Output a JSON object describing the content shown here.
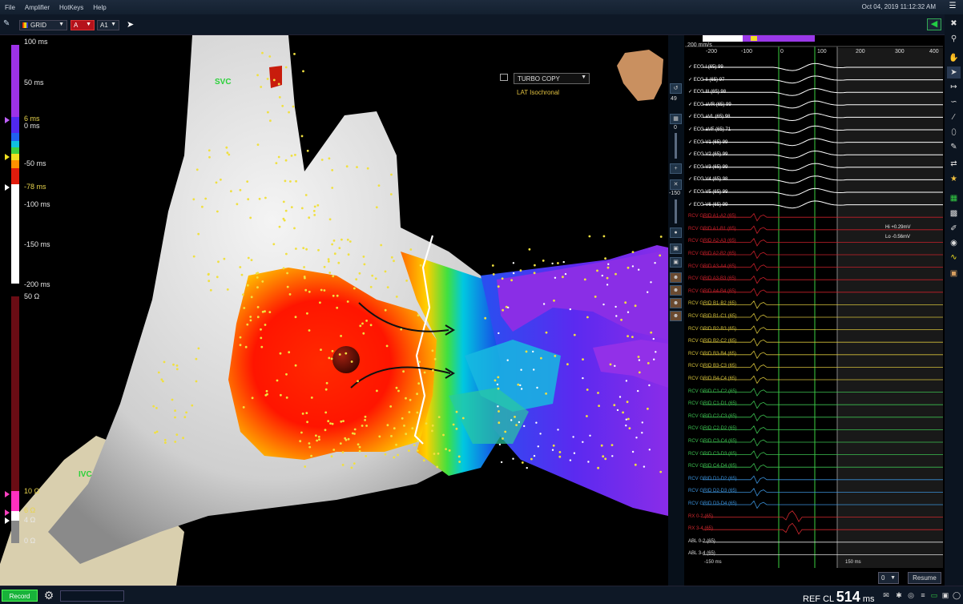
{
  "menu": {
    "items": [
      "File",
      "Amplifier",
      "HotKeys",
      "Help"
    ],
    "datetime": "Oct 04, 2019 11:12:32 AM"
  },
  "toolbar": {
    "map_select": "GRID",
    "channel_a": "A",
    "channel_b": "A1"
  },
  "lat_scale": {
    "labels": [
      "100 ms",
      "50 ms",
      "6 ms",
      "0 ms",
      "-50 ms",
      "-78 ms",
      "-100 ms",
      "-150 ms",
      "-200 ms"
    ]
  },
  "impedance_scale": {
    "labels": [
      "50 Ω",
      "10 Ω",
      "6 Ω",
      "4 Ω",
      "0 Ω"
    ]
  },
  "map": {
    "copy_mode": "TURBO COPY",
    "map_type": "LAT Isochronal",
    "label_svc": "SVC",
    "label_ivc": "IVC"
  },
  "midbar": {
    "value_49": "49",
    "value_0": "0",
    "value_neg150": "-150"
  },
  "traces": {
    "sweep": "200 mm/s",
    "axis_ticks": [
      "-200",
      "-100",
      "0",
      "100",
      "200",
      "300",
      "400"
    ],
    "window_left": "-150 ms",
    "window_right": "150 ms",
    "hi_label": "Hi +0.29mV",
    "lo_label": "Lo -0.56mV",
    "ecg": [
      "ECG I (65) 99",
      "ECG II (65) 97",
      "ECG III (65) 98",
      "ECG aVR (65) 99",
      "ECG aVL (65) 98",
      "ECG aVF (65) 71",
      "ECG V1 (65) 99",
      "ECG V2 (65) 99",
      "ECG V3 (65) 99",
      "ECG V4 (65) 98",
      "ECG V5 (65) 99",
      "ECG V6 (65) 99"
    ],
    "grid": [
      "RCV GRID A1-A2 (65)",
      "RCV GRID A1-B1 (65)",
      "RCV GRID A2-A3 (65)",
      "RCV GRID A2-B2 (65)",
      "RCV GRID A3-A4 (65)",
      "RCV GRID A3-B3 (65)",
      "RCV GRID A4-B4 (65)",
      "RCV GRID B1-B2 (65)",
      "RCV GRID B1-C1 (65)",
      "RCV GRID B2-B3 (65)",
      "RCV GRID B2-C2 (65)",
      "RCV GRID B3-B4 (65)",
      "RCV GRID B3-C3 (65)",
      "RCV GRID B4-C4 (65)",
      "RCV GRID C1-C2 (65)",
      "RCV GRID C1-D1 (65)",
      "RCV GRID C2-C3 (65)",
      "RCV GRID C2-D2 (65)",
      "RCV GRID C3-C4 (65)",
      "RCV GRID C3-D3 (65)",
      "RCV GRID C4-D4 (65)",
      "RCV GRID D1-D2 (65)",
      "RCV GRID D2-D3 (65)",
      "RCV GRID D3-D4 (65)",
      "RX 0-2 (65)",
      "RX 3-4 (65)",
      "ABL 0-2 (65)",
      "ABL 3-4 (65)"
    ],
    "zero_select": "0",
    "resume": "Resume"
  },
  "status": {
    "record": "Record",
    "ref_label": "REF",
    "cl_label": "CL",
    "cl_value": "514",
    "cl_unit": "ms"
  },
  "colors": {
    "accent": "#18b33a",
    "menubar": "#13202f",
    "grid_trace": "#d4c03a",
    "ecg_trace": "#ffffff",
    "rx_trace": "#d0282e"
  }
}
